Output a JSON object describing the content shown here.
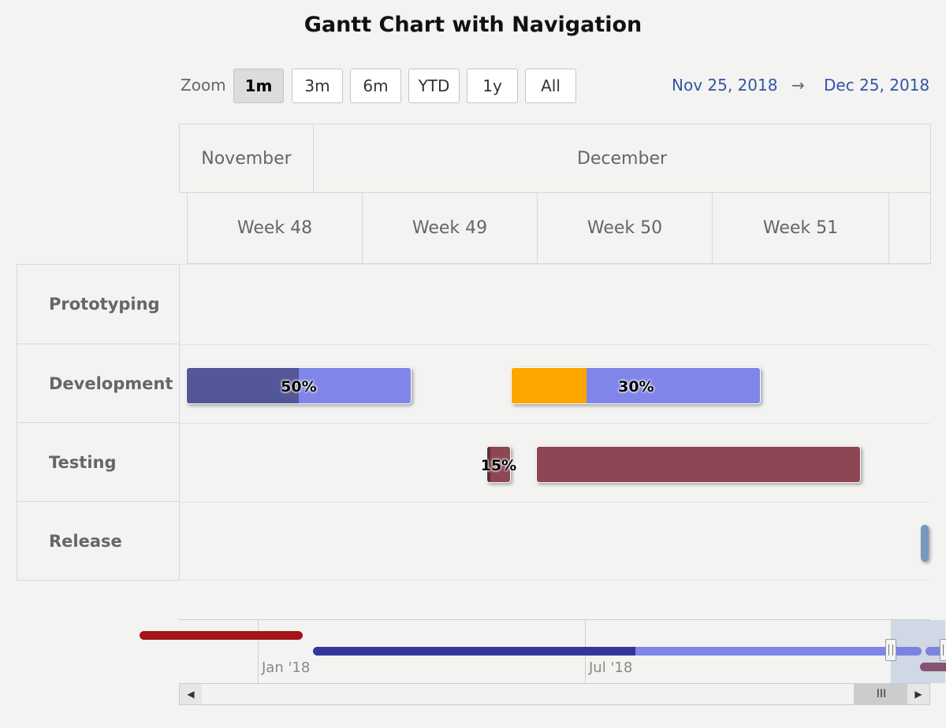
{
  "chart_data": {
    "type": "gantt",
    "title": "Gantt Chart with Navigation",
    "zoom": {
      "label": "Zoom",
      "options": [
        "1m",
        "3m",
        "6m",
        "YTD",
        "1y",
        "All"
      ],
      "selected": "1m"
    },
    "range": {
      "from": "Nov 25, 2018",
      "arrow": "→",
      "to": "Dec 25, 2018"
    },
    "x_axis": {
      "months": [
        "November",
        "December"
      ],
      "weeks": [
        "Week 48",
        "Week 49",
        "Week 50",
        "Week 51"
      ]
    },
    "categories": [
      "Prototyping",
      "Development",
      "Testing",
      "Release"
    ],
    "tasks": [
      {
        "category": "Development",
        "start": "2018-11-25",
        "end": "2018-12-04",
        "completed": 0.5,
        "label": "50%",
        "color": "#8085e9"
      },
      {
        "category": "Development",
        "start": "2018-12-08",
        "end": "2018-12-18",
        "completed": 0.3,
        "label": "30%",
        "color": "#8085e9",
        "completed_color": "#ffa500"
      },
      {
        "category": "Testing",
        "start": "2018-12-07",
        "end": "2018-12-08",
        "completed": 0.15,
        "label": "15%",
        "color": "#8d4654"
      },
      {
        "category": "Testing",
        "start": "2018-12-09",
        "end": "2018-12-22",
        "completed": 0,
        "label": "",
        "color": "#8d4654"
      },
      {
        "category": "Release",
        "start": "2018-12-25",
        "end": "2018-12-25",
        "completed": 0,
        "label": "",
        "color": "#7798bf"
      }
    ],
    "navigator": {
      "tick_labels": [
        "Jan '18",
        "Jul '18"
      ],
      "series": [
        {
          "start": "2017-10-01",
          "end": "2017-12-31",
          "color": "#a3141a"
        },
        {
          "start": "2018-01-06",
          "end": "2018-12-12",
          "completed": 0.53,
          "color": "#8085e9",
          "completed_color": "#34369a"
        },
        {
          "start": "2018-12-14",
          "end": "2018-12-25",
          "color": "#8085e9"
        },
        {
          "start": "2018-12-11",
          "end": "2018-12-31",
          "color": "#8d4654"
        }
      ],
      "selected_range": [
        "2018-11-25",
        "2018-12-25"
      ],
      "scrollbar_thumb_icon": "III"
    }
  }
}
